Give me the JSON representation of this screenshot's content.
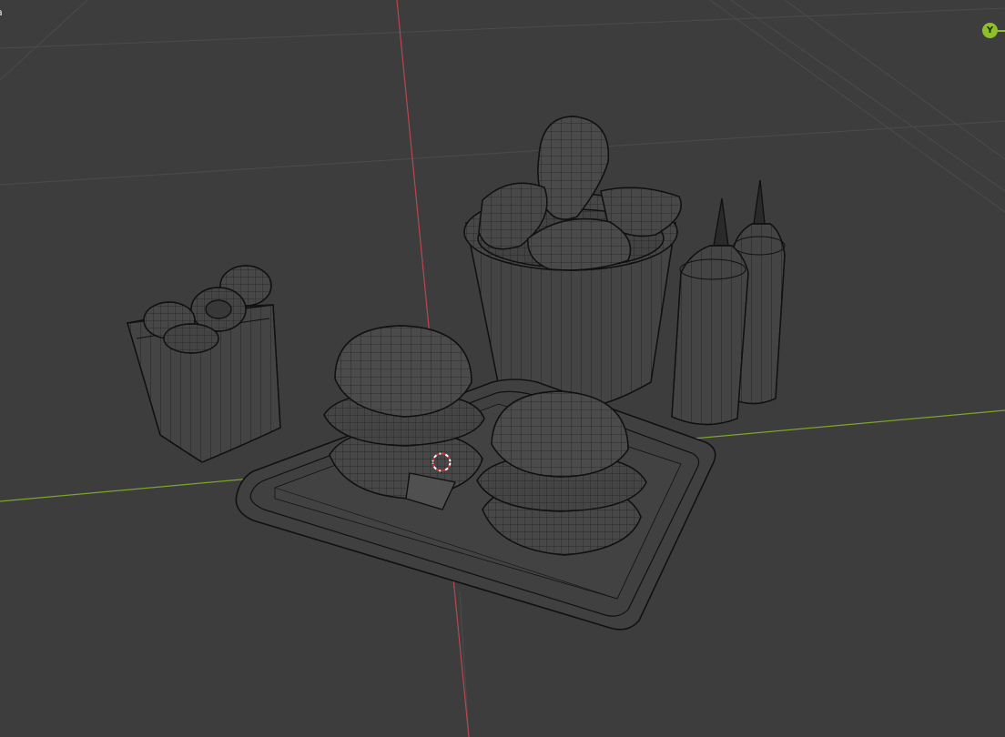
{
  "viewport": {
    "label": "a",
    "background": "#3d3d3d",
    "grid_color": "#4b4b4b",
    "x_axis_color": "#8cbf2a",
    "y_axis_color": "#c9484f",
    "wire_color": "#111111",
    "fill_color": "#454545"
  },
  "gizmo": {
    "axis_label": "Y",
    "color": "#8cbf2a"
  },
  "objects": [
    {
      "name": "onion-rings-box",
      "icon": "wireframe-mesh"
    },
    {
      "name": "chicken-bucket",
      "icon": "wireframe-mesh"
    },
    {
      "name": "sauce-bottle-left",
      "icon": "wireframe-mesh"
    },
    {
      "name": "sauce-bottle-right",
      "icon": "wireframe-mesh"
    },
    {
      "name": "serving-tray",
      "icon": "wireframe-mesh"
    },
    {
      "name": "burger-left",
      "icon": "wireframe-mesh"
    },
    {
      "name": "burger-right",
      "icon": "wireframe-mesh"
    }
  ],
  "cursor_3d": {
    "icon": "3d-cursor"
  }
}
